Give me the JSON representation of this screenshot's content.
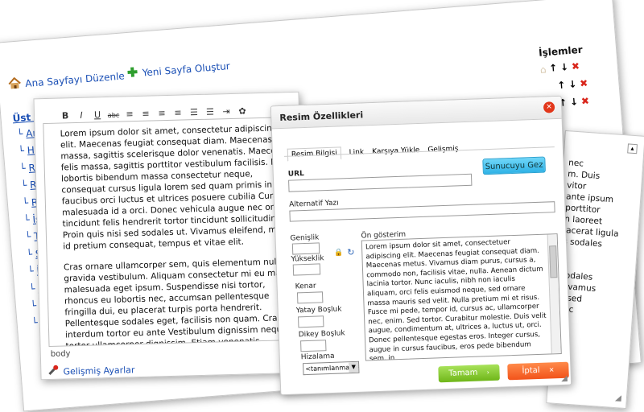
{
  "background_panel": {
    "edit_home_label": "Ana Sayfayı Düzenle",
    "new_page_label": "Yeni Sayfa Oluştur",
    "operations_header": "İşlemler",
    "top_menu_label": "Üst Menü",
    "menu_items": [
      "Ana",
      "Hak",
      "Ref",
      "Re",
      "Re",
      "İş",
      "T",
      "S",
      "İ",
      "S",
      "S",
      "S"
    ]
  },
  "right_panel": {
    "text_lines": [
      "nec",
      "m. Duis",
      "vitor",
      "ante ipsum",
      "porttitor",
      "n laoreet",
      "lacerat ligula",
      "s sodales",
      "c",
      "sodales",
      "Vivamus",
      "d sed",
      "nec"
    ]
  },
  "editor": {
    "toolbar_icons": [
      "bold-icon",
      "italic-icon",
      "underline-icon",
      "strikethrough-icon",
      "align-left-icon",
      "align-center-icon",
      "align-right-icon",
      "align-justify-icon",
      "bullet-list-icon",
      "numbered-list-icon",
      "indent-icon",
      "image-icon"
    ],
    "toolbar_glyphs": [
      "B",
      "I",
      "U",
      "abc",
      "≡",
      "≡",
      "≡",
      "≡",
      "☰",
      "☰",
      "⇥",
      "✿"
    ],
    "paragraph1": "Lorem ipsum dolor sit amet, consectetur adipiscing elit. Maecenas feugiat consequat diam. Maecenas felis massa, sagittis scelerisque dolor venenatis. Maecenas felis massa, sagittis porttitor vestibulum facilisis. Nunc lobortis bibendum massa consectetur neque, consequat cursus ligula lorem sed quam primis in faucibus orci luctus et ultrices posuere cubilia Curae; malesuada id a orci. Donec vehicula augue nec orci tincidunt felis hendrerit tortor tincidunt sollicitudin. Proin quis nisi sed sodales ut. Vivamus eleifend, massa id pretium consequat, tempus et vitae elit.",
    "paragraph2": "Cras ornare ullamcorper sem, quis elementum nulla gravida vestibulum. Aliquam consectetur mi eu magna malesuada eget ipsum. Suspendisse nisi tortor, rhoncus eu lobortis nec, accumsan pellentesque fringilla dui, eu placerat turpis porta hendrerit. Pellentesque sodales eget, facilisis non quam. Cras interdum tortor eu ante Vestibulum dignissim neque in tortor ullamcorper dignissim. Etiam venenatis fermentum velit, ut viverra odio hendrerit at. In hac h",
    "status_path": "body",
    "advanced_settings_label": "Gelişmiş Ayarlar"
  },
  "dialog": {
    "title": "Resim Özellikleri",
    "tabs": [
      "Resim Bilgisi",
      "Link",
      "Karşıya Yükle",
      "Gelişmiş"
    ],
    "url_label": "URL",
    "url_value": "",
    "browse_button_label": "Sunucuyu Gez",
    "alt_text_label": "Alternatif Yazı",
    "alt_text_value": "",
    "width_label": "Genişlik",
    "height_label": "Yükseklik",
    "border_label": "Kenar",
    "hspace_label": "Yatay Boşluk",
    "vspace_label": "Dikey Boşluk",
    "align_label": "Hizalama",
    "align_selected": "<tanımlanmamış>",
    "preview_label": "Ön gösterim",
    "preview_text": "Lorem ipsum dolor sit amet, consectetuer adipiscing elit. Maecenas feugiat consequat diam. Maecenas metus. Vivamus diam purus, cursus a, commodo non, facilisis vitae, nulla. Aenean dictum lacinia tortor. Nunc iaculis, nibh non iaculis aliquam, orci felis euismod neque, sed ornare massa mauris sed velit. Nulla pretium mi et risus. Fusce mi pede, tempor id, cursus ac, ullamcorper nec, enim. Sed tortor. Curabitur molestie. Duis velit augue, condimentum at, ultrices a, luctus ut, orci. Donec pellentesque egestas eros. Integer cursus, augue in cursus faucibus, eros pede bibendum sem, in",
    "ok_button_label": "Tamam",
    "cancel_button_label": "İptal"
  },
  "colors": {
    "link_blue": "#1a4fb5",
    "ok_green": "#7dc21e",
    "cancel_orange": "#f26522",
    "browse_cyan": "#35c0ec",
    "close_red": "#e2361a"
  }
}
